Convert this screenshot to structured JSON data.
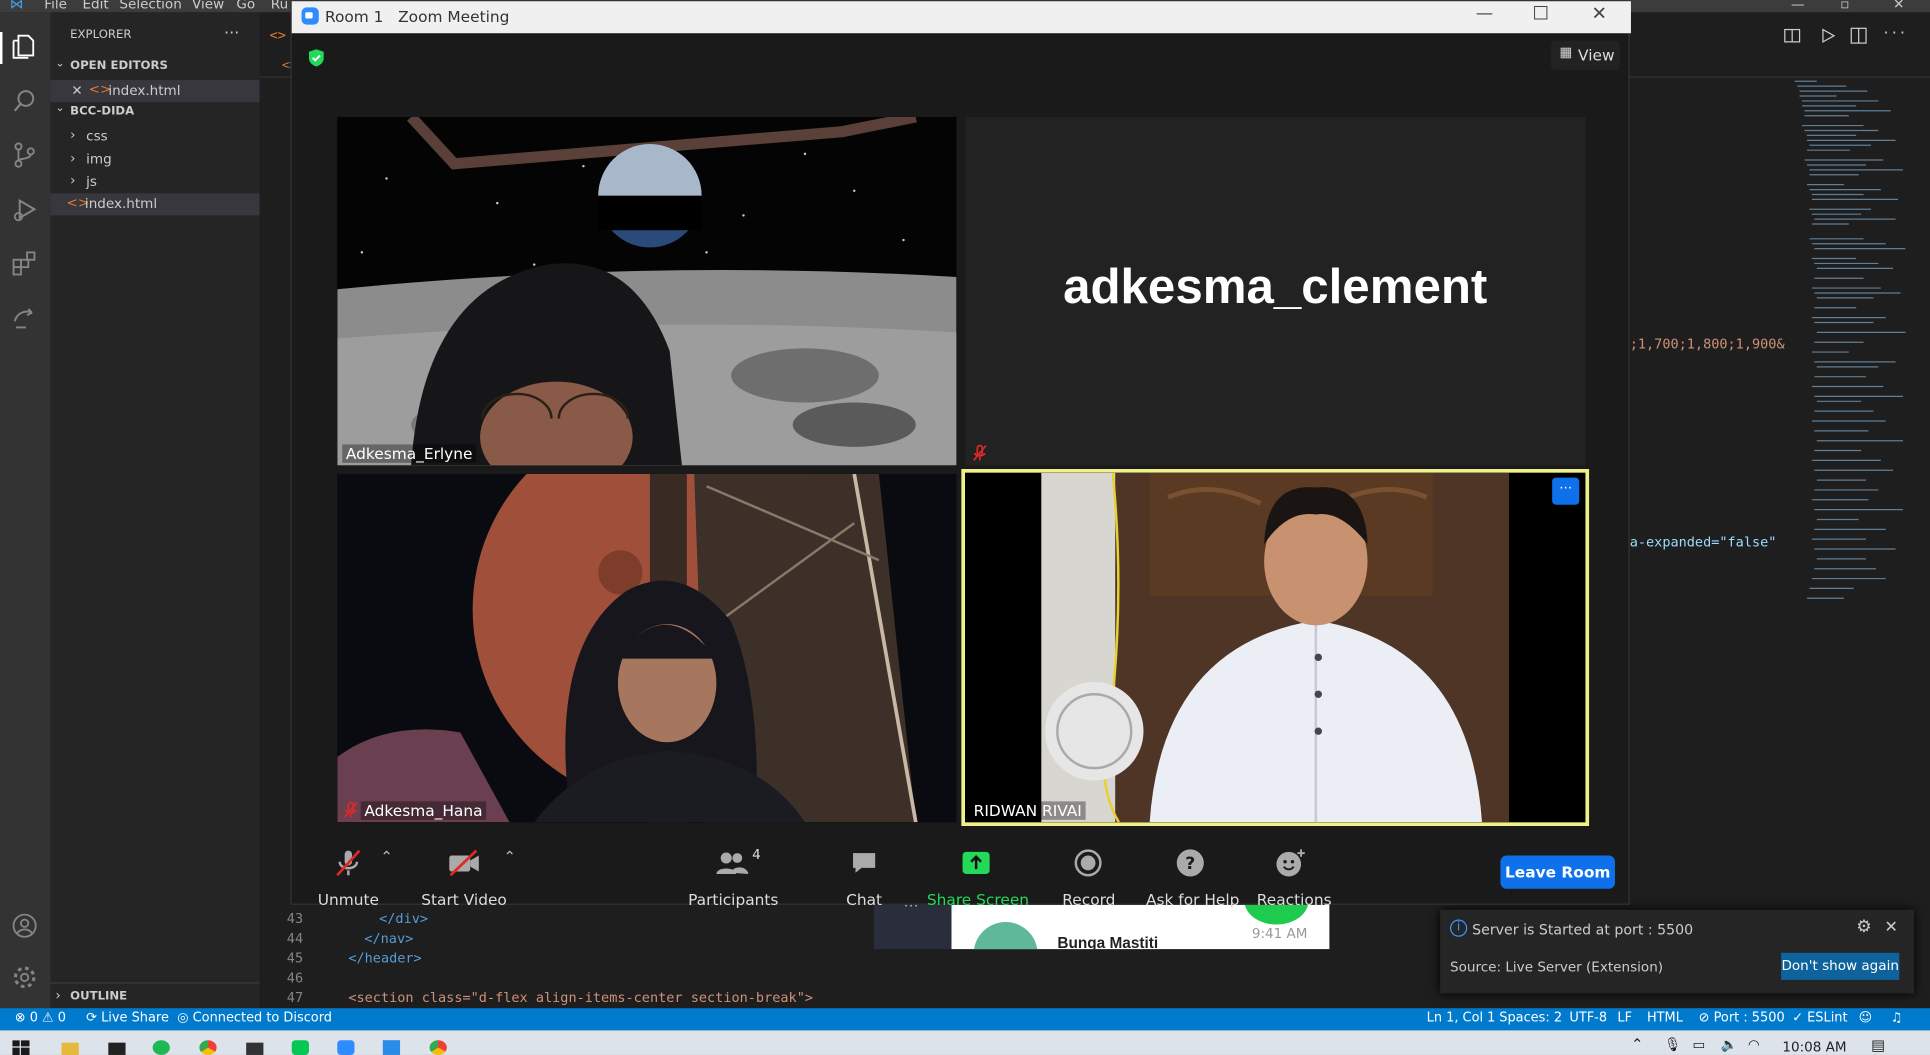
{
  "vscode": {
    "menu": [
      "File",
      "Edit",
      "Selection",
      "View",
      "Go",
      "Ru"
    ],
    "explorer_title": "EXPLORER",
    "open_editors": "OPEN EDITORS",
    "open_file": "index.html",
    "project": "BCC-DIDA",
    "tree": [
      "css",
      "img",
      "js",
      "index.html"
    ],
    "outline": "OUTLINE",
    "code_lines": [
      {
        "num": "43",
        "text": "</div>"
      },
      {
        "num": "44",
        "text": "</nav>"
      },
      {
        "num": "45",
        "text": "</header>"
      },
      {
        "num": "46",
        "text": ""
      },
      {
        "num": "47",
        "text": "<section class=\"d-flex align-items-center section-break\">"
      }
    ],
    "code_snippet_1": ";1,700;1,800;1,900&",
    "code_snippet_2": "a-expanded=\"false\"",
    "status": {
      "errors": "0",
      "warnings": "0",
      "live_share": "Live Share",
      "discord": "Connected to Discord",
      "position": "Ln 1, Col 1",
      "spaces": "Spaces: 2",
      "encoding": "UTF-8",
      "eol": "LF",
      "language": "HTML",
      "port": "Port : 5500",
      "linter": "ESLint"
    },
    "notification": {
      "message": "Server is Started at port : 5500",
      "source": "Source: Live Server (Extension)",
      "button": "Don't show again"
    },
    "chat_popup": {
      "name": "Bunga Mastiti",
      "time": "9:41 AM"
    }
  },
  "zoom": {
    "window_title": "Room 1   Zoom Meeting",
    "view_label": "View",
    "participants": [
      {
        "name": "Adkesma_Erlyne",
        "muted": false
      },
      {
        "name": "adkesma_clement",
        "muted": true
      },
      {
        "name": "Adkesma_Hana",
        "muted": true
      },
      {
        "name": "RIDWAN RIVAI",
        "muted": false
      }
    ],
    "toolbar": {
      "unmute": "Unmute",
      "start_video": "Start Video",
      "participants": "Participants",
      "participant_count": "4",
      "chat": "Chat",
      "share_screen": "Share Screen",
      "record": "Record",
      "ask_help": "Ask for Help",
      "reactions": "Reactions",
      "leave": "Leave Room"
    }
  },
  "taskbar": {
    "time": "10:08 AM"
  },
  "colors": {
    "vscode_blue": "#007acc",
    "zoom_blue": "#0e71eb",
    "share_green": "#23d959",
    "speaker_border": "#f0f08a"
  }
}
